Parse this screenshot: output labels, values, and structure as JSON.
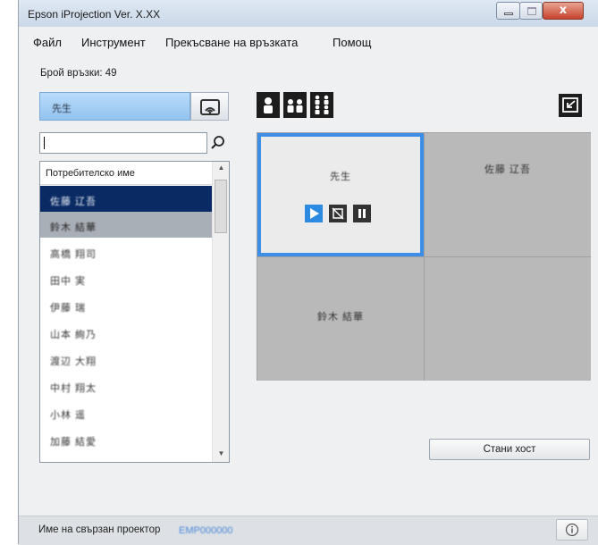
{
  "window": {
    "title": "Epson iProjection Ver. X.XX",
    "close_glyph": "x"
  },
  "menu": [
    "Файл",
    "Инструмент",
    "Прекъсване на връзката",
    "Помощ"
  ],
  "connections_label": "Брой връзки: 49",
  "host": {
    "name": "先生"
  },
  "search": {
    "value": "",
    "placeholder": ""
  },
  "user_list": {
    "header": "Потребителско име",
    "users": [
      "佐藤 辽吾",
      "鈴木 結華",
      "高橋 翔司",
      "田中 実",
      "伊藤 瑞",
      "山本 絢乃",
      "渡辺 大翔",
      "中村 翔太",
      "小林 遥",
      "加藤 結愛"
    ]
  },
  "grid": {
    "cells": [
      "先生",
      "佐藤 辽吾",
      "鈴木 結華",
      ""
    ]
  },
  "buttons": {
    "become_host": "Стани хост"
  },
  "status": {
    "label": "Име на свързан проектор",
    "projector": "EMP000000",
    "info_glyph": "ⓘ"
  },
  "colors": {
    "accent": "#3d8ee6",
    "selected_row": "#0a2a63",
    "host_box": "#a7cff4"
  }
}
